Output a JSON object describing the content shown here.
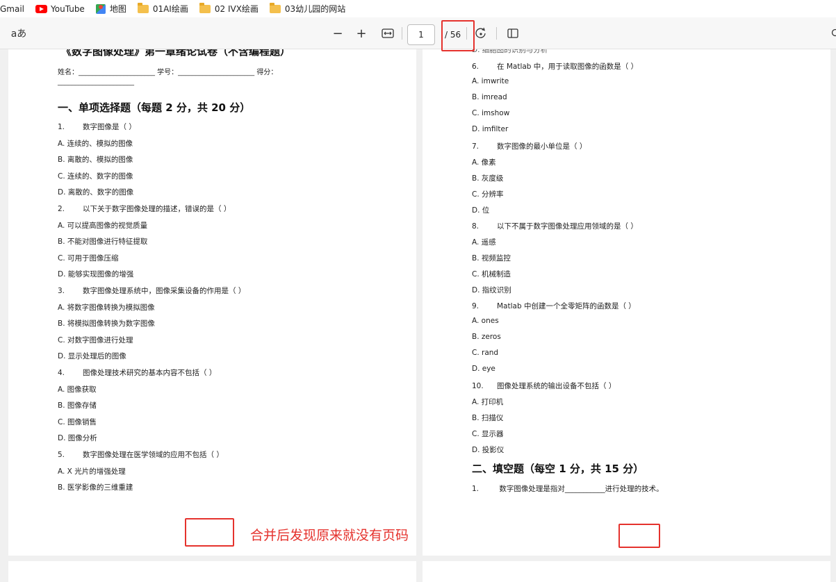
{
  "bookmarks": {
    "gmail": "Gmail",
    "youtube": "YouTube",
    "maps": "地图",
    "folder1": "01AI绘画",
    "folder2": "02 IVX绘画",
    "folder3": "03幼儿园的网站"
  },
  "toolbar": {
    "read_aloud": "aあ",
    "zoom_out": "−",
    "zoom_in": "+",
    "page_current": "1",
    "page_total": "/ 56"
  },
  "left_page": {
    "title": "《数字图像处理》第一章绪论试卷（不含编程题）",
    "info_line": "姓名：______________________ 学号：______________________ 得分：",
    "info_line2": "______________________",
    "section1": "一、单项选择题（每题 2 分，共 20 分）",
    "lines": [
      {
        "num": "1.",
        "text": "数字图像是（  ）"
      },
      {
        "num": "",
        "text": "A. 连续的、模拟的图像"
      },
      {
        "num": "",
        "text": "B. 离散的、模拟的图像"
      },
      {
        "num": "",
        "text": "C. 连续的、数字的图像"
      },
      {
        "num": "",
        "text": "D. 离散的、数字的图像"
      },
      {
        "num": "2.",
        "text": "以下关于数字图像处理的描述，错误的是（  ）"
      },
      {
        "num": "",
        "text": "A. 可以提高图像的视觉质量"
      },
      {
        "num": "",
        "text": "B. 不能对图像进行特征提取"
      },
      {
        "num": "",
        "text": "C. 可用于图像压缩"
      },
      {
        "num": "",
        "text": "D. 能够实现图像的增强"
      },
      {
        "num": "3.",
        "text": "数字图像处理系统中，图像采集设备的作用是（  ）"
      },
      {
        "num": "",
        "text": "A. 将数字图像转换为模拟图像"
      },
      {
        "num": "",
        "text": "B. 将模拟图像转换为数字图像"
      },
      {
        "num": "",
        "text": "C. 对数字图像进行处理"
      },
      {
        "num": "",
        "text": "D. 显示处理后的图像"
      },
      {
        "num": "4.",
        "text": "图像处理技术研究的基本内容不包括（  ）"
      },
      {
        "num": "",
        "text": "A. 图像获取"
      },
      {
        "num": "",
        "text": "B. 图像存储"
      },
      {
        "num": "",
        "text": "C. 图像销售"
      },
      {
        "num": "",
        "text": "D. 图像分析"
      },
      {
        "num": "5.",
        "text": "数字图像处理在医学领域的应用不包括（  ）"
      },
      {
        "num": "",
        "text": "A. X 光片的增强处理"
      },
      {
        "num": "",
        "text": "B. 医学影像的三维重建"
      }
    ]
  },
  "right_page": {
    "top_cut": "D. 细胞图的识别与分析",
    "lines": [
      {
        "num": "6.",
        "text": "在 Matlab 中，用于读取图像的函数是（  ）"
      },
      {
        "num": "",
        "text": "A. imwrite"
      },
      {
        "num": "",
        "text": "B. imread"
      },
      {
        "num": "",
        "text": "C. imshow"
      },
      {
        "num": "",
        "text": "D. imfilter"
      },
      {
        "num": "7.",
        "text": "数字图像的最小单位是（  ）"
      },
      {
        "num": "",
        "text": "A. 像素"
      },
      {
        "num": "",
        "text": "B. 灰度级"
      },
      {
        "num": "",
        "text": "C. 分辨率"
      },
      {
        "num": "",
        "text": "D. 位"
      },
      {
        "num": "8.",
        "text": "以下不属于数字图像处理应用领域的是（  ）"
      },
      {
        "num": "",
        "text": "A. 遥感"
      },
      {
        "num": "",
        "text": "B. 视频监控"
      },
      {
        "num": "",
        "text": "C. 机械制造"
      },
      {
        "num": "",
        "text": "D. 指纹识别"
      },
      {
        "num": "9.",
        "text": "Matlab 中创建一个全零矩阵的函数是（  ）"
      },
      {
        "num": "",
        "text": "A. ones"
      },
      {
        "num": "",
        "text": "B. zeros"
      },
      {
        "num": "",
        "text": "C. rand"
      },
      {
        "num": "",
        "text": "D. eye"
      },
      {
        "num": "10.",
        "text": "图像处理系统的输出设备不包括（  ）"
      },
      {
        "num": "",
        "text": "A. 打印机"
      },
      {
        "num": "",
        "text": "B. 扫描仪"
      },
      {
        "num": "",
        "text": "C. 显示器"
      },
      {
        "num": "",
        "text": "D. 投影仪"
      }
    ],
    "section2": "二、填空题（每空 1 分，共 15 分）",
    "fill1_num": "1.",
    "fill1_text": "数字图像处理是指对___________进行处理的技术。"
  },
  "annotation": {
    "text": "合并后发现原来就没有页码",
    "color": "#e5322d"
  }
}
